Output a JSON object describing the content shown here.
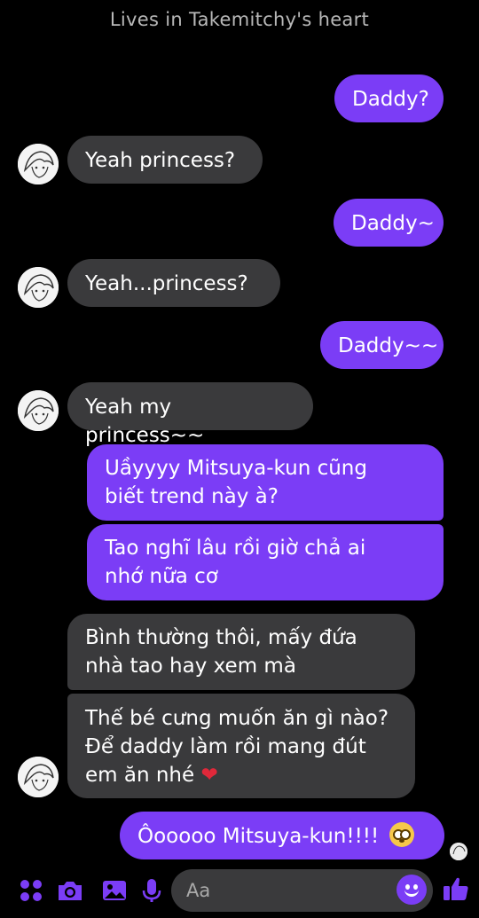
{
  "header": {
    "status": "Lives in Takemitchy's heart"
  },
  "messages": {
    "m1": "Daddy?",
    "m2": "Yeah princess?",
    "m3": "Daddy~",
    "m4": "Yeah...princess?",
    "m5": "Daddy~~",
    "m6": "Yeah my princess~~",
    "m7_l1": "Uầyyyy Mitsuya-kun cũng",
    "m7_l2": "biết trend này à?",
    "m8_l1": "Tao nghĩ lâu rồi giờ chả ai",
    "m8_l2": "nhớ nữa cơ",
    "m9_l1": "Bình thường thôi, mấy đứa",
    "m9_l2": "nhà tao hay xem mà",
    "m10_l1": "Thế bé cưng muốn ăn gì nào?",
    "m10_l2": "Để daddy làm rồi mang đút",
    "m10_l3": "em ăn nhé",
    "m10_emoji": "❤",
    "m11": "Ôooooo Mitsuya-kun!!!!"
  },
  "composer": {
    "placeholder": "Aa"
  },
  "colors": {
    "outgoing": "#7b3df6",
    "incoming": "#3a3a3c",
    "accent": "#7b3df6",
    "background": "#000000"
  },
  "icons": [
    "menu-dots-icon",
    "camera-icon",
    "gallery-icon",
    "microphone-icon",
    "emoji-icon",
    "thumbs-up-icon",
    "flushed-face-emoji",
    "heart-emoji"
  ]
}
